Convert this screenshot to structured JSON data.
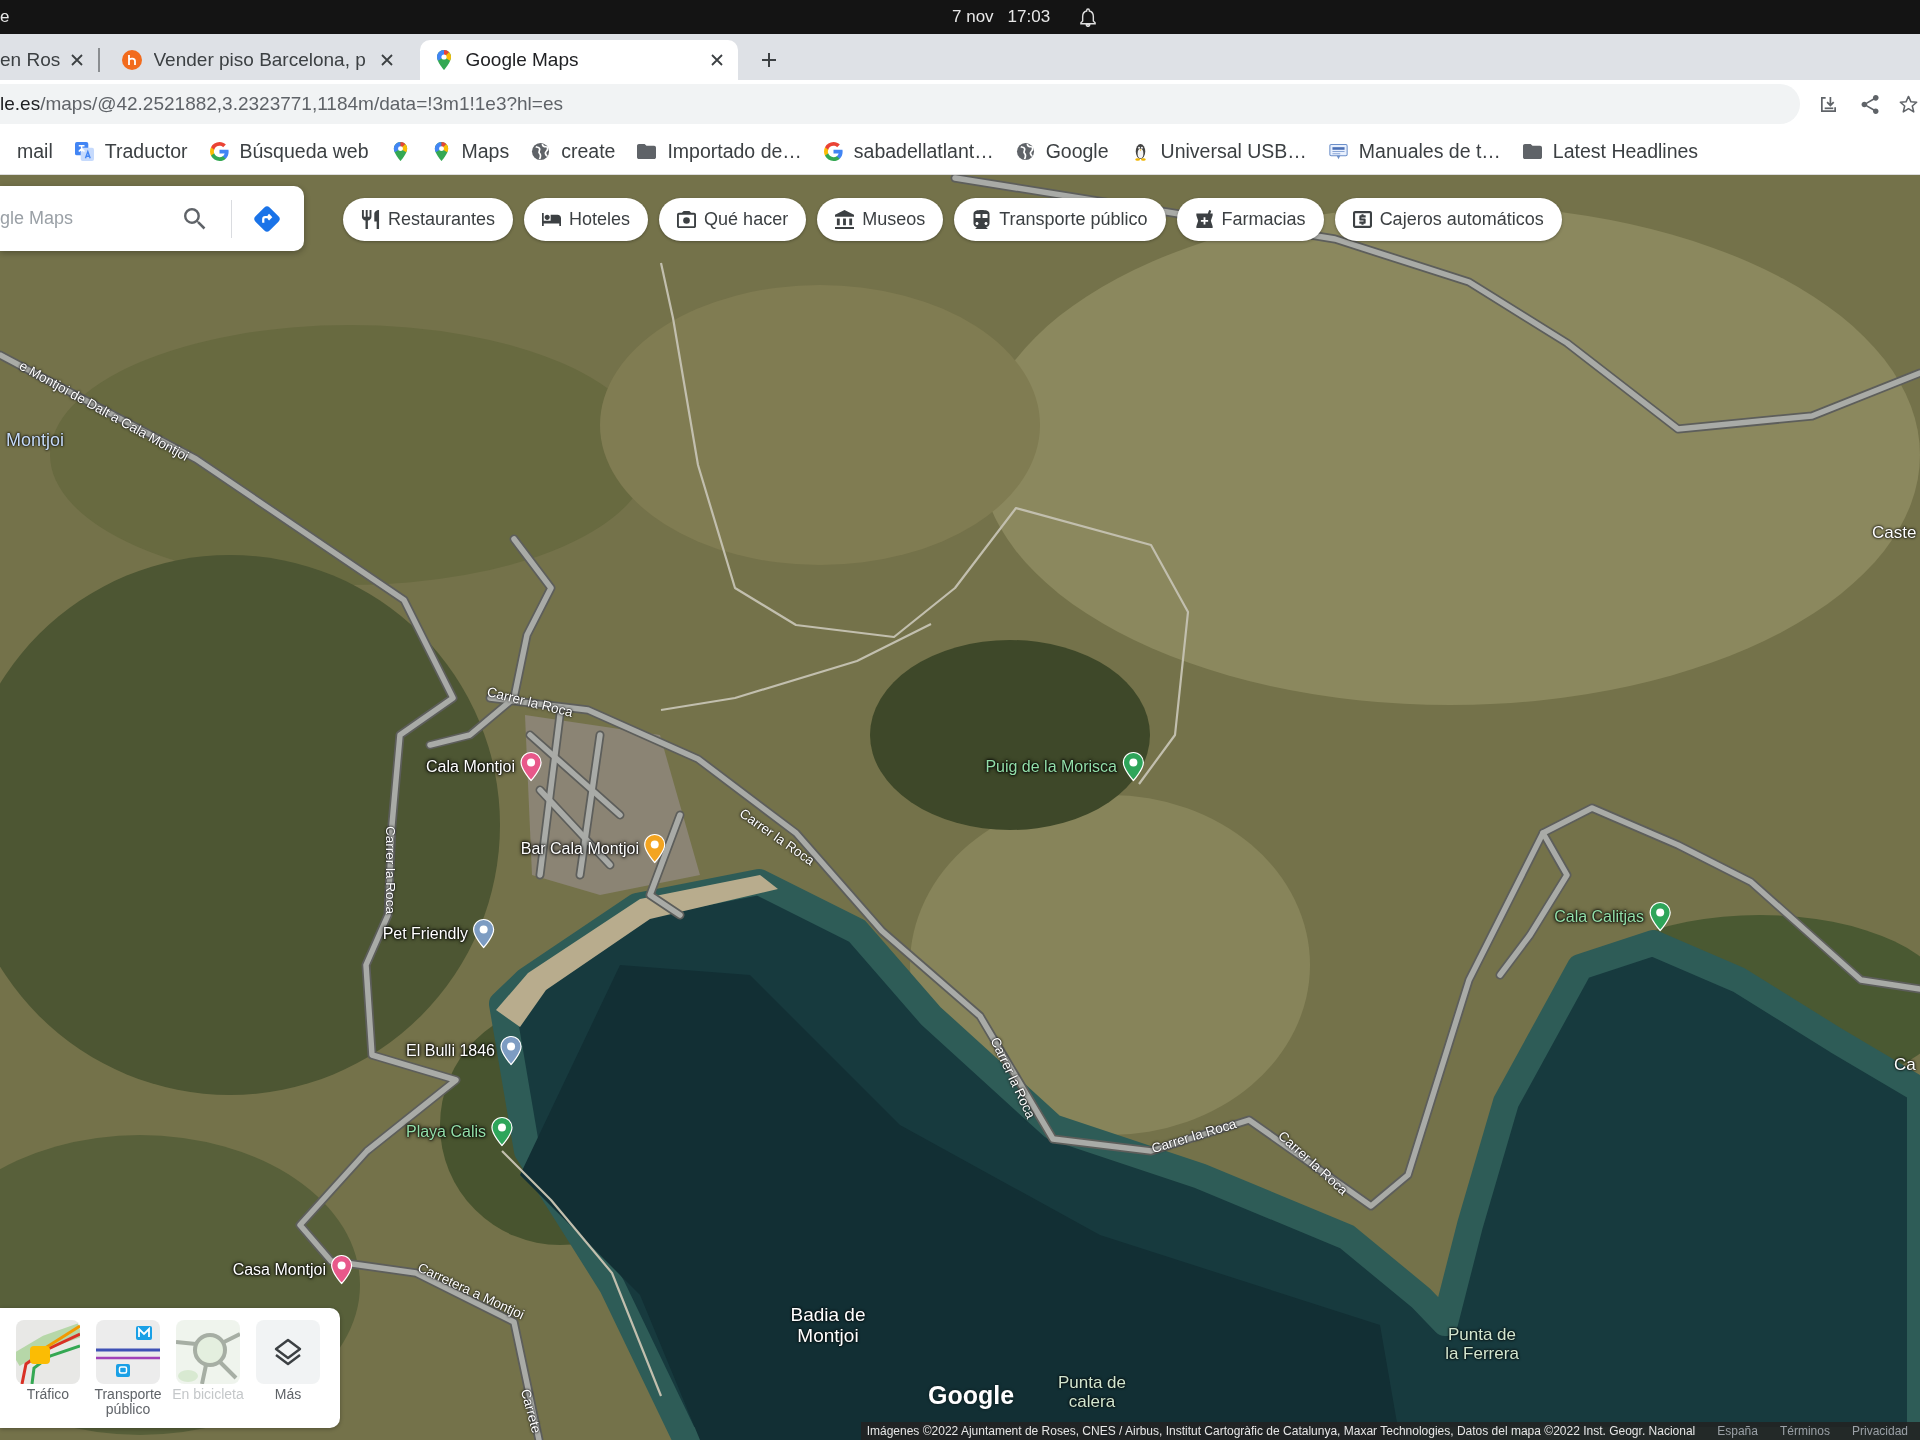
{
  "system_bar": {
    "label": "e",
    "date": "7 nov",
    "time": "17:03"
  },
  "tabs": [
    {
      "title": "en Ros",
      "selected": false,
      "kind": "text"
    },
    {
      "title": "Vender piso Barcelona, p",
      "selected": false,
      "kind": "site"
    },
    {
      "title": "Google Maps",
      "selected": true,
      "kind": "maps"
    }
  ],
  "address_bar": {
    "host": "le.es",
    "path": "/maps/@42.2521882,3.2323771,1184m/data=!3m1!1e3?hl=es"
  },
  "bookmarks": [
    {
      "label": "mail",
      "kind": "text"
    },
    {
      "label": "Traductor",
      "kind": "translate"
    },
    {
      "label": "Búsqueda web",
      "kind": "google"
    },
    {
      "kind": "maps"
    },
    {
      "label": "Maps",
      "kind": "maps"
    },
    {
      "label": "create",
      "kind": "globe"
    },
    {
      "label": "Importado de…",
      "kind": "folder"
    },
    {
      "label": "sabadellatlant…",
      "kind": "google"
    },
    {
      "label": "Google",
      "kind": "globe"
    },
    {
      "label": "Universal USB…",
      "kind": "penguin"
    },
    {
      "label": "Manuales de t…",
      "kind": "manual"
    },
    {
      "label": "Latest Headlines",
      "kind": "folder"
    }
  ],
  "map": {
    "search": {
      "placeholder": "gle Maps"
    },
    "categories": [
      {
        "label": "Restaurantes",
        "kind": "restaurant"
      },
      {
        "label": "Hoteles",
        "kind": "hotel"
      },
      {
        "label": "Qué hacer",
        "kind": "camera"
      },
      {
        "label": "Museos",
        "kind": "museum"
      },
      {
        "label": "Transporte público",
        "kind": "train"
      },
      {
        "label": "Farmacias",
        "kind": "pharmacy"
      },
      {
        "label": "Cajeros automáticos",
        "kind": "atm"
      }
    ],
    "area_labels": [
      {
        "name": "Montjoi",
        "kind": "locality"
      },
      {
        "name": "Caste",
        "kind": "label"
      },
      {
        "name": "Ca",
        "kind": "label"
      },
      {
        "name": "Badia de\nMontjoi",
        "kind": "water"
      },
      {
        "name": "Punta de\nla Ferrera",
        "kind": "natural"
      },
      {
        "name": "Punta de\ncalera",
        "kind": "natural"
      }
    ],
    "road_labels": [
      {
        "name": "e Montjoi de Dalt a Cala Montjoi"
      },
      {
        "name": "Carrer la Roca"
      },
      {
        "name": "Carrer la Roca"
      },
      {
        "name": "Carrer la Roca"
      },
      {
        "name": "Carretera a Montjoi"
      },
      {
        "name": "Carrer la Roca"
      },
      {
        "name": "Carrer la Roca"
      },
      {
        "name": "Carrer la Roca"
      },
      {
        "name": "Carrete"
      }
    ],
    "places": [
      {
        "name": "Cala Montjoi",
        "kind": "business",
        "color": "#e8588a"
      },
      {
        "name": "Puig de la Morisca",
        "kind": "nature",
        "color": "#2ea55a"
      },
      {
        "name": "Bar Cala Montjoi",
        "kind": "business",
        "color": "#f3a420"
      },
      {
        "name": "Cala Calitjas",
        "kind": "nature",
        "color": "#2ea55a"
      },
      {
        "name": "Pet Friendly",
        "kind": "business",
        "color": "#7d9cc2"
      },
      {
        "name": "El Bulli 1846",
        "kind": "business",
        "color": "#7d9cc2"
      },
      {
        "name": "Playa Calis",
        "kind": "nature",
        "color": "#2ea55a"
      },
      {
        "name": "Casa Montjoi",
        "kind": "business",
        "color": "#e8588a"
      }
    ],
    "layers": [
      {
        "label": "Tráfico",
        "kind": "traffic",
        "disabled": false
      },
      {
        "label": "Transporte público",
        "kind": "transit",
        "disabled": false
      },
      {
        "label": "En bicicleta",
        "kind": "bike",
        "disabled": true
      },
      {
        "label": "Más",
        "kind": "more",
        "disabled": false
      }
    ],
    "logo": "Google",
    "attribution": {
      "text": "Imágenes ©2022 Ajuntament de Roses, CNES / Airbus, Institut Cartogràfic de Catalunya, Maxar Technologies, Datos del mapa ©2022 Inst. Geogr. Nacional",
      "links": [
        "España",
        "Términos",
        "Privacidad"
      ]
    }
  }
}
